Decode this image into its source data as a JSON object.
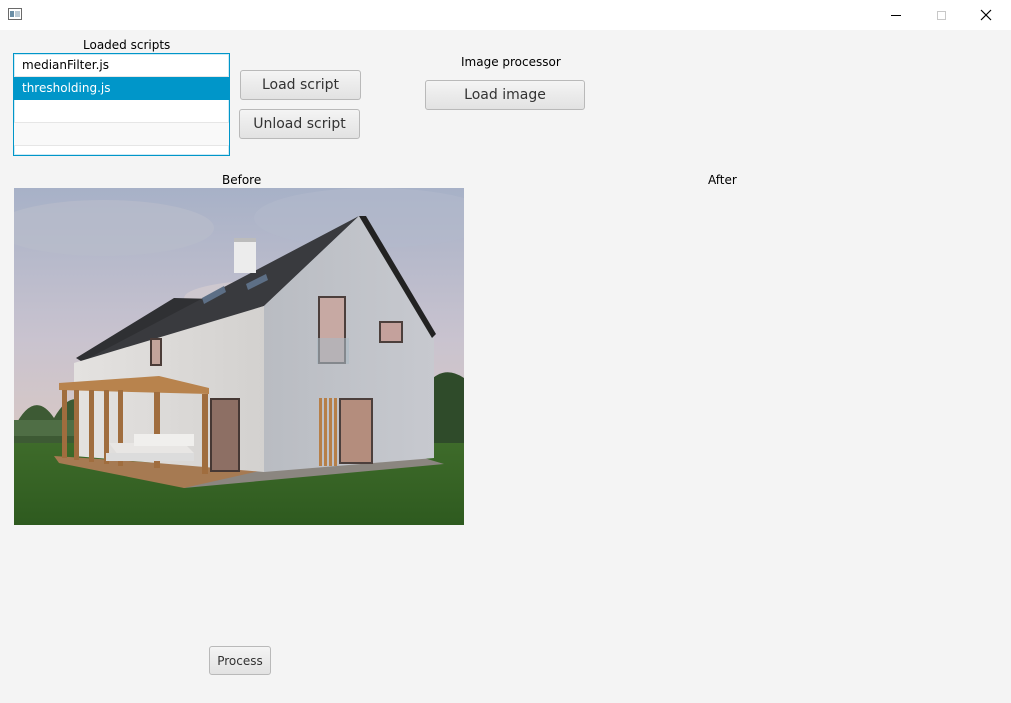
{
  "window": {
    "title": ""
  },
  "scripts": {
    "label": "Loaded scripts",
    "items": [
      "medianFilter.js",
      "thresholding.js",
      "",
      ""
    ],
    "selected_index": 1,
    "load_label": "Load script",
    "unload_label": "Unload script"
  },
  "processor": {
    "label": "Image processor",
    "load_image_label": "Load image"
  },
  "images": {
    "before_label": "Before",
    "after_label": "After"
  },
  "process_label": "Process",
  "icons": {
    "app": "app-window-icon",
    "minimize": "minimize-icon",
    "maximize": "maximize-icon",
    "close": "close-icon"
  },
  "colors": {
    "selection": "#0096c9",
    "background": "#f4f4f4"
  }
}
